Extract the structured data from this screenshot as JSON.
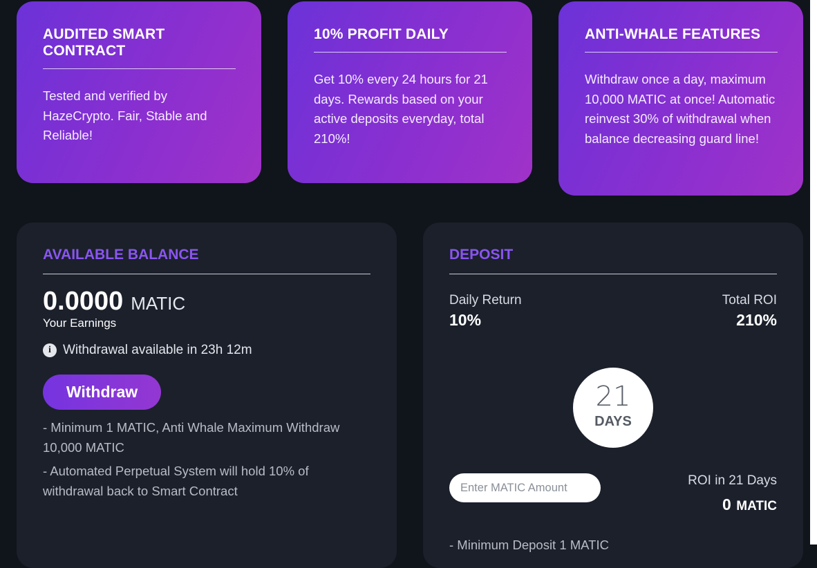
{
  "features": [
    {
      "title": "AUDITED SMART CONTRACT",
      "text": "Tested and verified by HazeCrypto. Fair, Stable and Reliable!"
    },
    {
      "title": "10% PROFIT DAILY",
      "text": "Get 10% every 24 hours for 21 days. Rewards based on your active deposits everyday, total 210%!"
    },
    {
      "title": "ANTI-WHALE FEATURES",
      "text": "Withdraw once a day, maximum 10,000 MATIC at once! Automatic reinvest 30% of withdrawal when balance decreasing guard line!"
    }
  ],
  "balance": {
    "title": "AVAILABLE BALANCE",
    "value": "0.0000",
    "unit": "MATIC",
    "earnings_label": "Your Earnings",
    "withdraw_info": "Withdrawal available in 23h 12m",
    "withdraw_button": "Withdraw",
    "notes": [
      "- Minimum 1 MATIC, Anti Whale Maximum Withdraw 10,000 MATIC",
      "- Automated Perpetual System will hold 10% of withdrawal back to Smart Contract"
    ]
  },
  "deposit": {
    "title": "DEPOSIT",
    "daily_return_label": "Daily Return",
    "daily_return_value": "10%",
    "total_roi_label": "Total ROI",
    "total_roi_value": "210%",
    "days_number": "21",
    "days_label": "DAYS",
    "amount_placeholder": "Enter MATIC Amount",
    "roi_days_label": "ROI in 21 Days",
    "roi_days_value": "0",
    "roi_days_unit": "MATIC",
    "notes": [
      "- Minimum Deposit 1 MATIC"
    ]
  },
  "colors": {
    "accent_purple": "#8a55f0",
    "card_gradient_start": "#6b32d8",
    "card_gradient_end": "#a032c8",
    "panel_bg": "#1b202b",
    "page_bg": "#10141b"
  }
}
